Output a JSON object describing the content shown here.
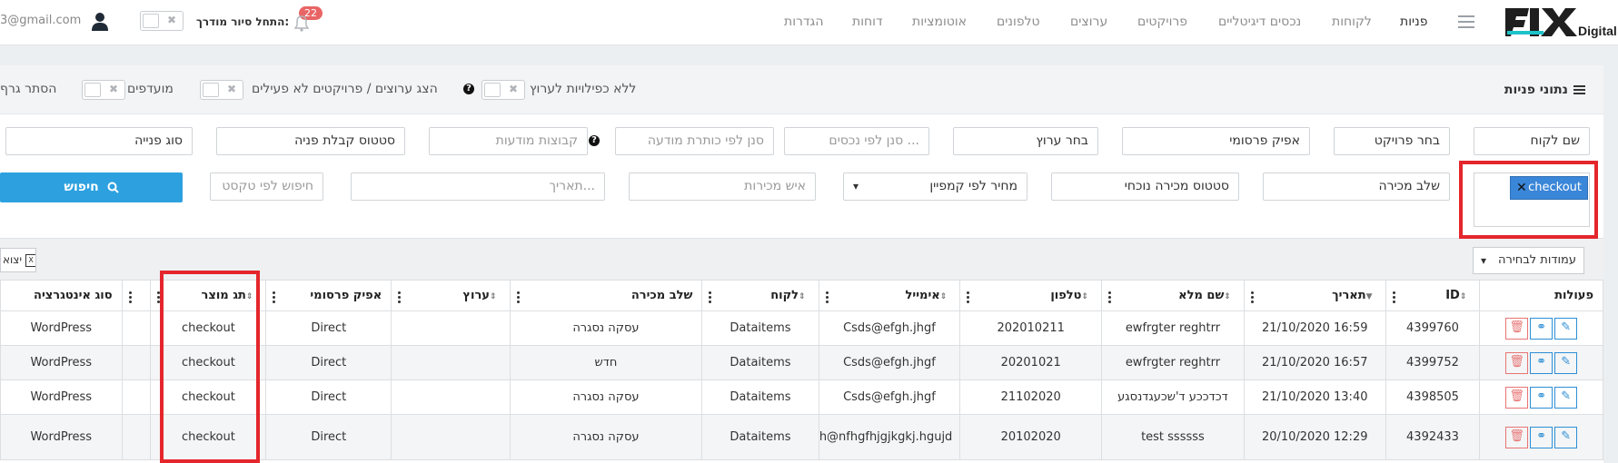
{
  "nav": {
    "brand": "FIX Digital",
    "items": [
      "פניות",
      "לקוחות",
      "נכסים דיגיטליים",
      "פרויקטים",
      "ערוצים",
      "טלפונים",
      "אוטומציות",
      "דוחות",
      "הגדרות"
    ],
    "active_index": 0,
    "tour_label": "התחל סיור מודרך:",
    "notification_count": "22",
    "email": "3@gmail.com"
  },
  "panel": {
    "title": "נתוני פניות",
    "no_dup_label": "ללא כפילויות לערוץ",
    "show_inactive_label": "הצג ערוצים / פרויקטים לא פעילים",
    "favorites_label": "מועדפים",
    "hide_graph_label": "הסתר גרף"
  },
  "filters": {
    "row1": [
      "שם לקוח",
      "בחר פרויקט",
      "אפיק פרסומי",
      "בחר ערוץ",
      "סנן לפי נכסים ...",
      "סנן לפי כותרת מודעה",
      "קבוצות מודעות",
      "סטטוס קבלת פניה",
      "סוג פנייה"
    ],
    "sales_stage": "שלב מכירה",
    "sales_status": "סטטוס מכירה נוכחי",
    "campaign_price": "מחיר לפי קמפיין",
    "salesman_ph": "איש מכירות",
    "date_ph": "תאריך...",
    "text_search_ph": "חיפוש לפי טקסט",
    "search_button": "חיפוש",
    "product_tag_value": "checkout"
  },
  "table": {
    "columns_button": "עמודות לבחירה",
    "export_button": "יצוא",
    "headers": [
      "פעולות",
      "ID",
      "תאריך",
      "שם מלא",
      "טלפון",
      "אימייל",
      "לקוח",
      "שלב מכירה",
      "ערוץ",
      "אפיק פרסומי",
      "תג מוצר",
      "",
      "סוג אינטגרציה"
    ],
    "rows": [
      [
        "4399760",
        "16:59 21/10/2020",
        "ewfrgter reghtrr",
        "202010211",
        "Csds@efgh.jhgf",
        "Dataitems",
        "עסקה נסגרה",
        "",
        "Direct",
        "checkout",
        "",
        "WordPress"
      ],
      [
        "4399752",
        "16:57 21/10/2020",
        "ewfrgter reghtrr",
        "20201021",
        "Csds@efgh.jhgf",
        "Dataitems",
        "חדש",
        "",
        "Direct",
        "checkout",
        "",
        "WordPress"
      ],
      [
        "4398505",
        "13:40 21/10/2020",
        "דכדככע ד'שכעגדנסגע",
        "21102020",
        "Csds@efgh.jhgf",
        "Dataitems",
        "עסקה נסגרה",
        "",
        "Direct",
        "checkout",
        "",
        "WordPress"
      ],
      [
        "4392433",
        "12:29 20/10/2020",
        "test ssssss",
        "20102020",
        "fghfh@nfhgfhjgjkgkj.hgujd",
        "Dataitems",
        "עסקה נסגרה",
        "",
        "Direct",
        "checkout",
        "",
        "WordPress"
      ]
    ]
  },
  "colors": {
    "accent": "#2da1e0",
    "highlight": "#e4262c",
    "badge": "#e96565",
    "chip": "#3a86d8"
  }
}
